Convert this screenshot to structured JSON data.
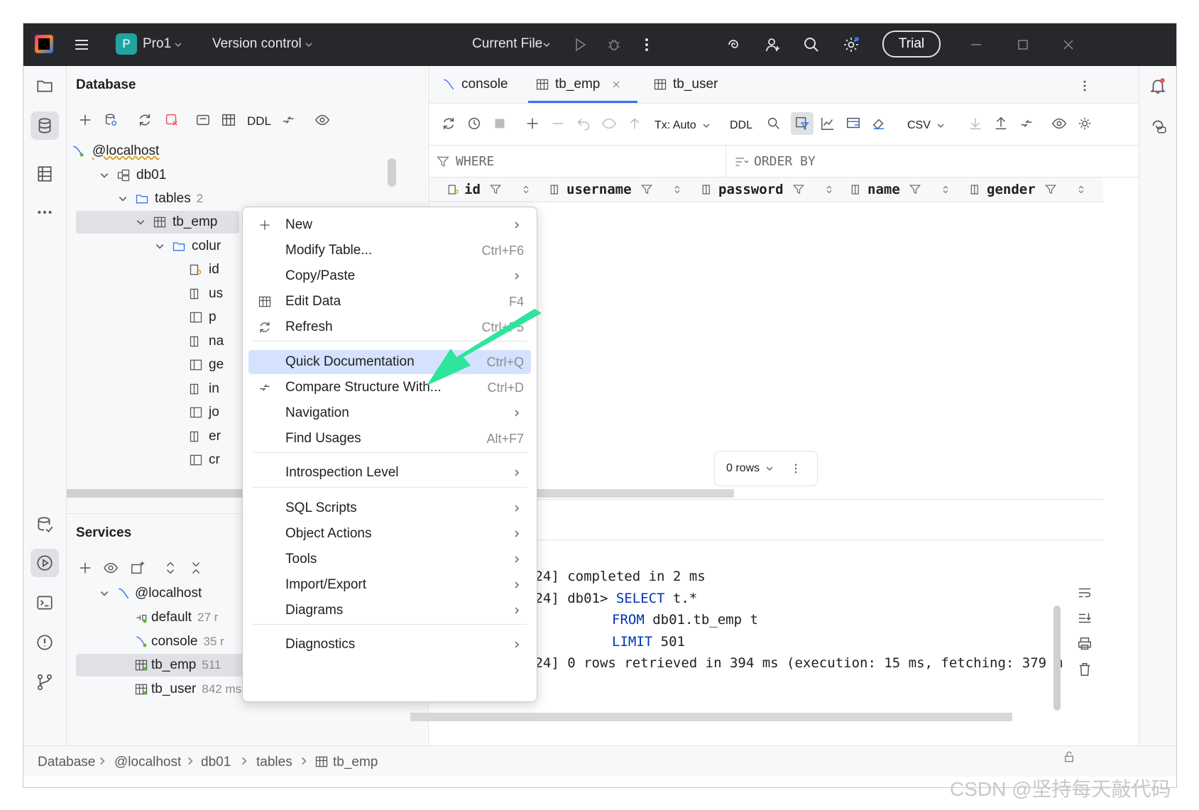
{
  "titlebar": {
    "project_badge": "P",
    "project_name": "Pro1",
    "vcs_label": "Version control",
    "run_config": "Current File",
    "trial_label": "Trial"
  },
  "database_panel": {
    "title": "Database",
    "toolbar_ddl": "DDL",
    "tree": {
      "host": "@localhost",
      "schema": "db01",
      "tables_label": "tables",
      "tables_count": "2",
      "table": "tb_emp",
      "columns_label": "colur",
      "columns": [
        "id",
        "us",
        "p",
        "na",
        "ge",
        "in",
        "jo",
        "er",
        "cr"
      ]
    }
  },
  "services_panel": {
    "title": "Services",
    "host": "@localhost",
    "items": [
      {
        "label": "default",
        "time": "27 r"
      },
      {
        "label": "console",
        "time": "35 r"
      },
      {
        "label": "tb_emp",
        "time": "511"
      },
      {
        "label": "tb_user",
        "time": "842 ms"
      }
    ]
  },
  "editor": {
    "tabs": [
      {
        "label": "console"
      },
      {
        "label": "tb_emp"
      },
      {
        "label": "tb_user"
      }
    ],
    "toolbar": {
      "tx_label": "Tx: Auto",
      "ddl_label": "DDL",
      "csv_label": "CSV"
    },
    "where_label": "WHERE",
    "order_by_label": "ORDER BY",
    "columns": [
      "id",
      "username",
      "password",
      "name",
      "gender"
    ],
    "rows_label": "0 rows",
    "console_lines": [
      {
        "prefix": ":24] ",
        "text": "completed in 2 ms"
      },
      {
        "prefix": ":24] ",
        "text": "db01> ",
        "kw": "SELECT",
        "rest": " t.*"
      },
      {
        "prefix": "",
        "kw": "FROM",
        "rest": " db01.tb_emp t"
      },
      {
        "prefix": "",
        "kw": "LIMIT",
        "rest": " 501"
      },
      {
        "prefix": ":24] ",
        "text": "0 rows retrieved in 394 ms (execution: 15 ms, fetching: 379 m"
      }
    ]
  },
  "context_menu": {
    "items": [
      {
        "label": "New",
        "shortcut": "",
        "submenu": true
      },
      {
        "label": "Modify Table...",
        "shortcut": "Ctrl+F6",
        "submenu": false
      },
      {
        "label": "Copy/Paste",
        "shortcut": "",
        "submenu": true
      },
      {
        "label": "Edit Data",
        "shortcut": "F4",
        "submenu": false
      },
      {
        "label": "Refresh",
        "shortcut": "Ctrl+F5",
        "submenu": false
      },
      {
        "label": "Quick Documentation",
        "shortcut": "Ctrl+Q",
        "submenu": false
      },
      {
        "label": "Compare Structure With...",
        "shortcut": "Ctrl+D",
        "submenu": false
      },
      {
        "label": "Navigation",
        "shortcut": "",
        "submenu": true
      },
      {
        "label": "Find Usages",
        "shortcut": "Alt+F7",
        "submenu": false
      },
      {
        "label": "Introspection Level",
        "shortcut": "",
        "submenu": true
      },
      {
        "label": "SQL Scripts",
        "shortcut": "",
        "submenu": true
      },
      {
        "label": "Object Actions",
        "shortcut": "",
        "submenu": true
      },
      {
        "label": "Tools",
        "shortcut": "",
        "submenu": true
      },
      {
        "label": "Import/Export",
        "shortcut": "",
        "submenu": true
      },
      {
        "label": "Diagrams",
        "shortcut": "",
        "submenu": true
      },
      {
        "label": "Diagnostics",
        "shortcut": "",
        "submenu": true
      }
    ]
  },
  "statusbar": {
    "breadcrumbs": [
      "Database",
      "@localhost",
      "db01",
      "tables",
      "tb_emp"
    ]
  },
  "watermark": "CSDN @坚持每天敲代码",
  "colors": {
    "titlebar_bg": "#27282c",
    "accent": "#3574f0",
    "menu_highlight": "#d4e2ff",
    "arrow": "#2ecc71"
  }
}
